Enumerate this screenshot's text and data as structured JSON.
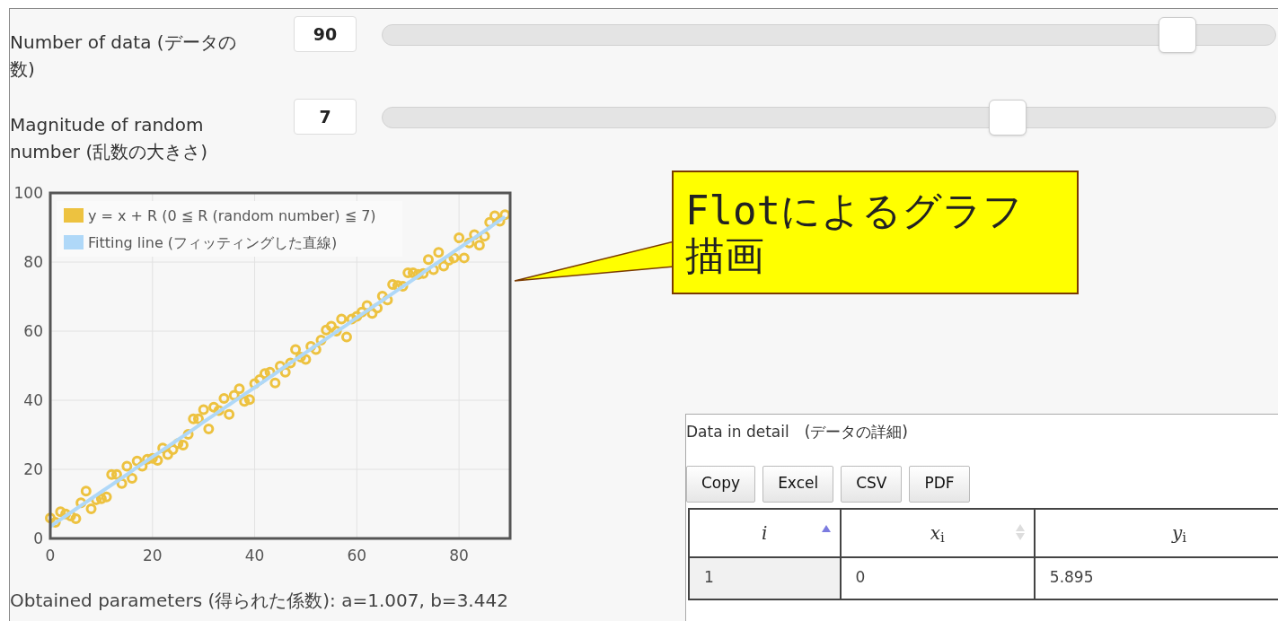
{
  "controls": [
    {
      "label": "Number of data (データの数)",
      "value": "90",
      "level": 0.89
    },
    {
      "label": "Magnitude of random number (乱数の大きさ)",
      "value": "7",
      "level": 0.7
    }
  ],
  "chart": {
    "chart_data": {
      "type": "scatter",
      "grid": true,
      "legend": "upper left",
      "x": [
        0,
        1,
        2,
        3,
        4,
        5,
        6,
        7,
        8,
        9,
        10,
        11,
        12,
        13,
        14,
        15,
        16,
        17,
        18,
        19,
        20,
        21,
        22,
        23,
        24,
        25,
        26,
        27,
        28,
        29,
        30,
        31,
        32,
        33,
        34,
        35,
        36,
        37,
        38,
        39,
        40,
        41,
        42,
        43,
        44,
        45,
        46,
        47,
        48,
        49,
        50,
        51,
        52,
        53,
        54,
        55,
        56,
        57,
        58,
        59,
        60,
        61,
        62,
        63,
        64,
        65,
        66,
        67,
        68,
        69,
        70,
        71,
        72,
        73,
        74,
        75,
        76,
        77,
        78,
        79,
        80,
        81,
        82,
        83,
        84,
        85,
        86,
        87,
        88,
        89
      ],
      "xlim": [
        0,
        90
      ],
      "ylim": [
        0,
        100
      ],
      "xticks": [
        0,
        20,
        40,
        60,
        80
      ],
      "yticks": [
        0,
        20,
        40,
        60,
        80,
        100
      ],
      "series": [
        {
          "name": "y = x + R (0 ≦ R (random number) ≦ 7)",
          "type": "scatter",
          "color": "#edc240",
          "values": [
            5.9,
            4.7,
            7.7,
            7.1,
            6.5,
            5.7,
            10.3,
            13.7,
            8.6,
            11.2,
            11.5,
            12,
            18.5,
            18.5,
            15.9,
            20.9,
            17.4,
            22.4,
            20.9,
            22.9,
            23.2,
            22.6,
            26.2,
            24.3,
            25.7,
            27.5,
            27,
            30.1,
            34.6,
            34.6,
            37.3,
            31.7,
            38,
            37,
            40.5,
            35.9,
            41.4,
            43.3,
            39.7,
            40.2,
            44.8,
            46,
            47.7,
            48.1,
            45,
            49.9,
            48.1,
            50.8,
            54.7,
            52.5,
            51.8,
            55.6,
            54.7,
            57.4,
            60.3,
            61.4,
            60,
            63.5,
            58.3,
            63.5,
            64.3,
            65.5,
            67.4,
            65.1,
            66.7,
            70.1,
            69,
            73.5,
            73.2,
            73,
            76.9,
            76.9,
            76.4,
            76.7,
            80.7,
            77.8,
            82.8,
            78.8,
            80.5,
            81.2,
            87,
            81.2,
            85.5,
            87.9,
            84.9,
            87.5,
            91.5,
            93.4,
            91.8,
            93.7
          ]
        },
        {
          "name": "Fitting line (フィッティングした直線)",
          "type": "line",
          "color": "#afd8f8",
          "values": [
            3.4,
            4.5,
            5.5,
            6.5,
            7.5,
            8.5,
            9.5,
            10.5,
            11.5,
            12.5,
            13.5,
            14.5,
            15.5,
            16.5,
            17.5,
            18.5,
            19.6,
            20.6,
            21.6,
            22.6,
            23.6,
            24.6,
            25.6,
            26.6,
            27.6,
            28.6,
            29.6,
            30.6,
            31.6,
            32.6,
            33.7,
            34.7,
            35.7,
            36.7,
            37.7,
            38.7,
            39.7,
            40.7,
            41.7,
            42.7,
            43.7,
            44.7,
            45.7,
            46.7,
            47.7,
            48.8,
            49.8,
            50.8,
            51.8,
            52.8,
            53.8,
            54.8,
            55.8,
            56.8,
            57.8,
            58.8,
            59.8,
            60.8,
            61.8,
            62.9,
            63.9,
            64.9,
            65.9,
            66.9,
            67.9,
            68.9,
            69.9,
            70.9,
            71.9,
            72.9,
            73.9,
            74.9,
            75.9,
            77.0,
            78.0,
            79.0,
            80.0,
            81.0,
            82.0,
            83.0,
            84.0,
            85.0,
            86.0,
            87.0,
            88.0,
            89.0,
            90.0,
            91.1,
            92.1,
            93.1
          ]
        }
      ]
    }
  },
  "result": "Obtained parameters (得られた係数): a=1.007, b=3.442",
  "callout": "Flotによるグラフ描画",
  "table_panel": {
    "title": "Data in detail　(データの詳細)",
    "buttons": [
      "Copy",
      "Excel",
      "CSV",
      "PDF"
    ],
    "columns": [
      {
        "label": "*i*",
        "sorted": true
      },
      {
        "label": "*x*$_{i}$",
        "sorted": false
      },
      {
        "label": "*y*$_{i}$"
      }
    ],
    "rows": [
      [
        "1",
        "0",
        "5.895"
      ]
    ]
  }
}
